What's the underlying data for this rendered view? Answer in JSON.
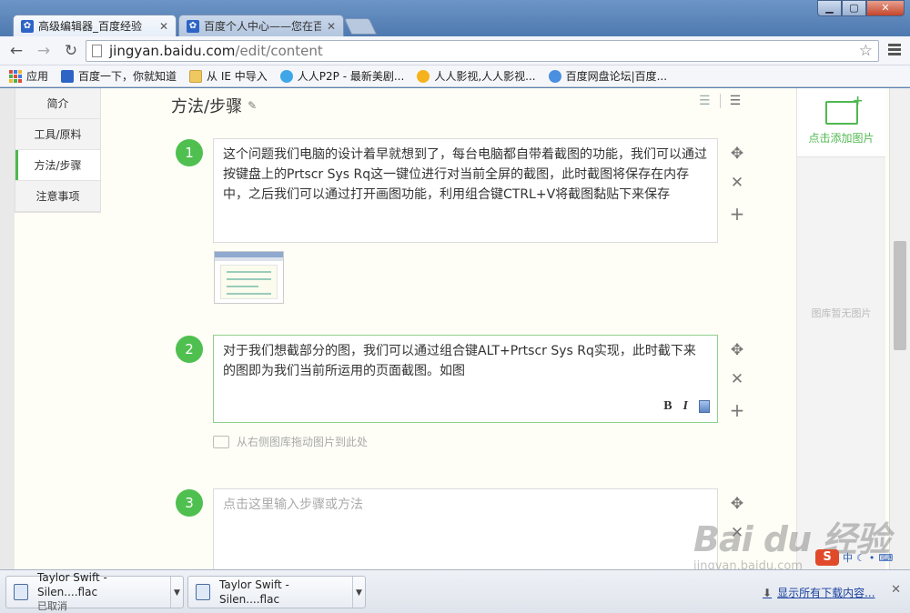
{
  "browser": {
    "tabs": [
      {
        "title": "高级编辑器_百度经验",
        "active": true
      },
      {
        "title": "百度个人中心——您在百...",
        "active": false
      }
    ],
    "url_host": "jingyan.baidu.com",
    "url_path": "/edit/content",
    "bookmarks": [
      {
        "label": "应用",
        "icon": "apps-grid-icon"
      },
      {
        "label": "百度一下，你就知道",
        "icon": "baidu-paw-icon"
      },
      {
        "label": "从 IE 中导入",
        "icon": "folder-icon"
      },
      {
        "label": "人人P2P - 最新美剧...",
        "icon": "p2p-icon"
      },
      {
        "label": "人人影视,人人影视...",
        "icon": "rrys-icon"
      },
      {
        "label": "百度网盘论坛|百度...",
        "icon": "baidu-pan-icon"
      }
    ]
  },
  "sidebar": {
    "items": [
      {
        "label": "简介",
        "active": false
      },
      {
        "label": "工具/原料",
        "active": false
      },
      {
        "label": "方法/步骤",
        "active": true
      },
      {
        "label": "注意事项",
        "active": false
      }
    ]
  },
  "main": {
    "section_title": "方法/步骤",
    "steps": [
      {
        "number": "1",
        "text": "这个问题我们电脑的设计着早就想到了，每台电脑都自带着截图的功能，我们可以通过按键盘上的Prtscr Sys Rq这一键位进行对当前全屏的截图，此时截图将保存在内存中，之后我们可以通过打开画图功能，利用组合键CTRL+V将截图黏贴下来保存"
      },
      {
        "number": "2",
        "text": "对于我们想截部分的图，我们可以通过组合键ALT+Prtscr Sys Rq实现，此时截下来的图即为我们当前所运用的页面截图。如图"
      },
      {
        "number": "3",
        "placeholder": "点击这里输入步骤或方法"
      }
    ],
    "format_bold": "B",
    "format_italic": "I",
    "drag_hint": "从右侧图库拖动图片到此处"
  },
  "right_panel": {
    "add_image_label": "点击添加图片",
    "empty_text": "图库暂无图片"
  },
  "watermark": {
    "brand": "Bai du 经验",
    "domain": "jingyan.baidu.com"
  },
  "tray": {
    "ime": "S",
    "ime_lang": "中"
  },
  "downloads": {
    "items": [
      {
        "name": "Taylor Swift - Silen....flac",
        "status": "已取消"
      },
      {
        "name": "Taylor Swift - Silen....flac",
        "status": ""
      }
    ],
    "show_all": "显示所有下载内容..."
  },
  "colors": {
    "accent_green": "#4fc04f",
    "link_blue": "#1a3f9e"
  }
}
